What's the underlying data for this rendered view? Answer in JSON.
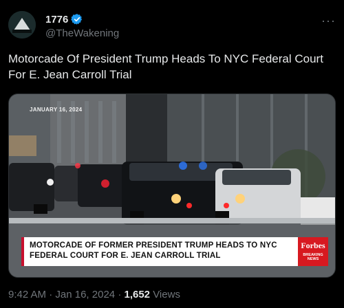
{
  "post": {
    "display_name": "1776",
    "handle": "@TheWakening",
    "text": "Motorcade Of President Trump Heads To NYC Federal Court For E. Jean Carroll Trial",
    "time": "9:42 AM",
    "separator": "·",
    "date": "Jan 16, 2024",
    "views_count": "1,652",
    "views_label": "Views",
    "more_label": "···"
  },
  "media": {
    "date_stamp": "JANUARY 16, 2024",
    "caption_line1": "MOTORCADE OF FORMER PRESIDENT TRUMP HEADS TO NYC",
    "caption_line2": "FEDERAL COURT FOR E. JEAN CARROLL TRIAL",
    "network_logo": "Forbes",
    "network_breaking": "BREAKING NEWS"
  },
  "colors": {
    "background": "#000000",
    "text": "#e7e9ea",
    "muted": "#71767b",
    "verified": "#1d9bf0",
    "forbes_red": "#d71920"
  },
  "icons": [
    "verified-badge-icon",
    "more-options-icon"
  ]
}
